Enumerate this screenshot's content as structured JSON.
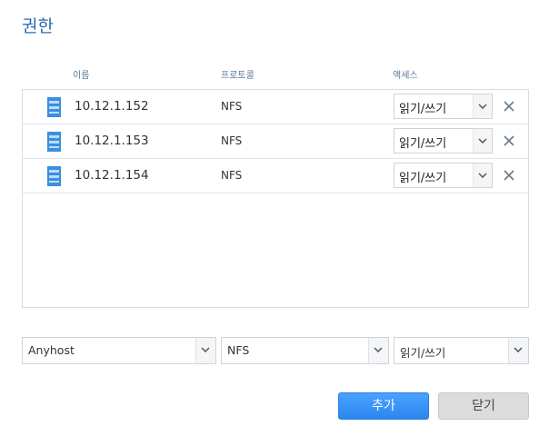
{
  "dialog": {
    "title": "권한"
  },
  "columns": {
    "name": "이름",
    "protocol": "프로토콜",
    "access": "액세스"
  },
  "rows": [
    {
      "name": "10.12.1.152",
      "protocol": "NFS",
      "access": "읽기/쓰기",
      "icon": "server-icon"
    },
    {
      "name": "10.12.1.153",
      "protocol": "NFS",
      "access": "읽기/쓰기",
      "icon": "server-icon"
    },
    {
      "name": "10.12.1.154",
      "protocol": "NFS",
      "access": "읽기/쓰기",
      "icon": "server-icon"
    }
  ],
  "add_form": {
    "host": "Anyhost",
    "protocol": "NFS",
    "access": "읽기/쓰기"
  },
  "buttons": {
    "add": "추가",
    "close": "닫기"
  },
  "colors": {
    "accent": "#2a6bb3",
    "primary_button": "#2b86f0",
    "server_icon": "#3b8ee0"
  }
}
